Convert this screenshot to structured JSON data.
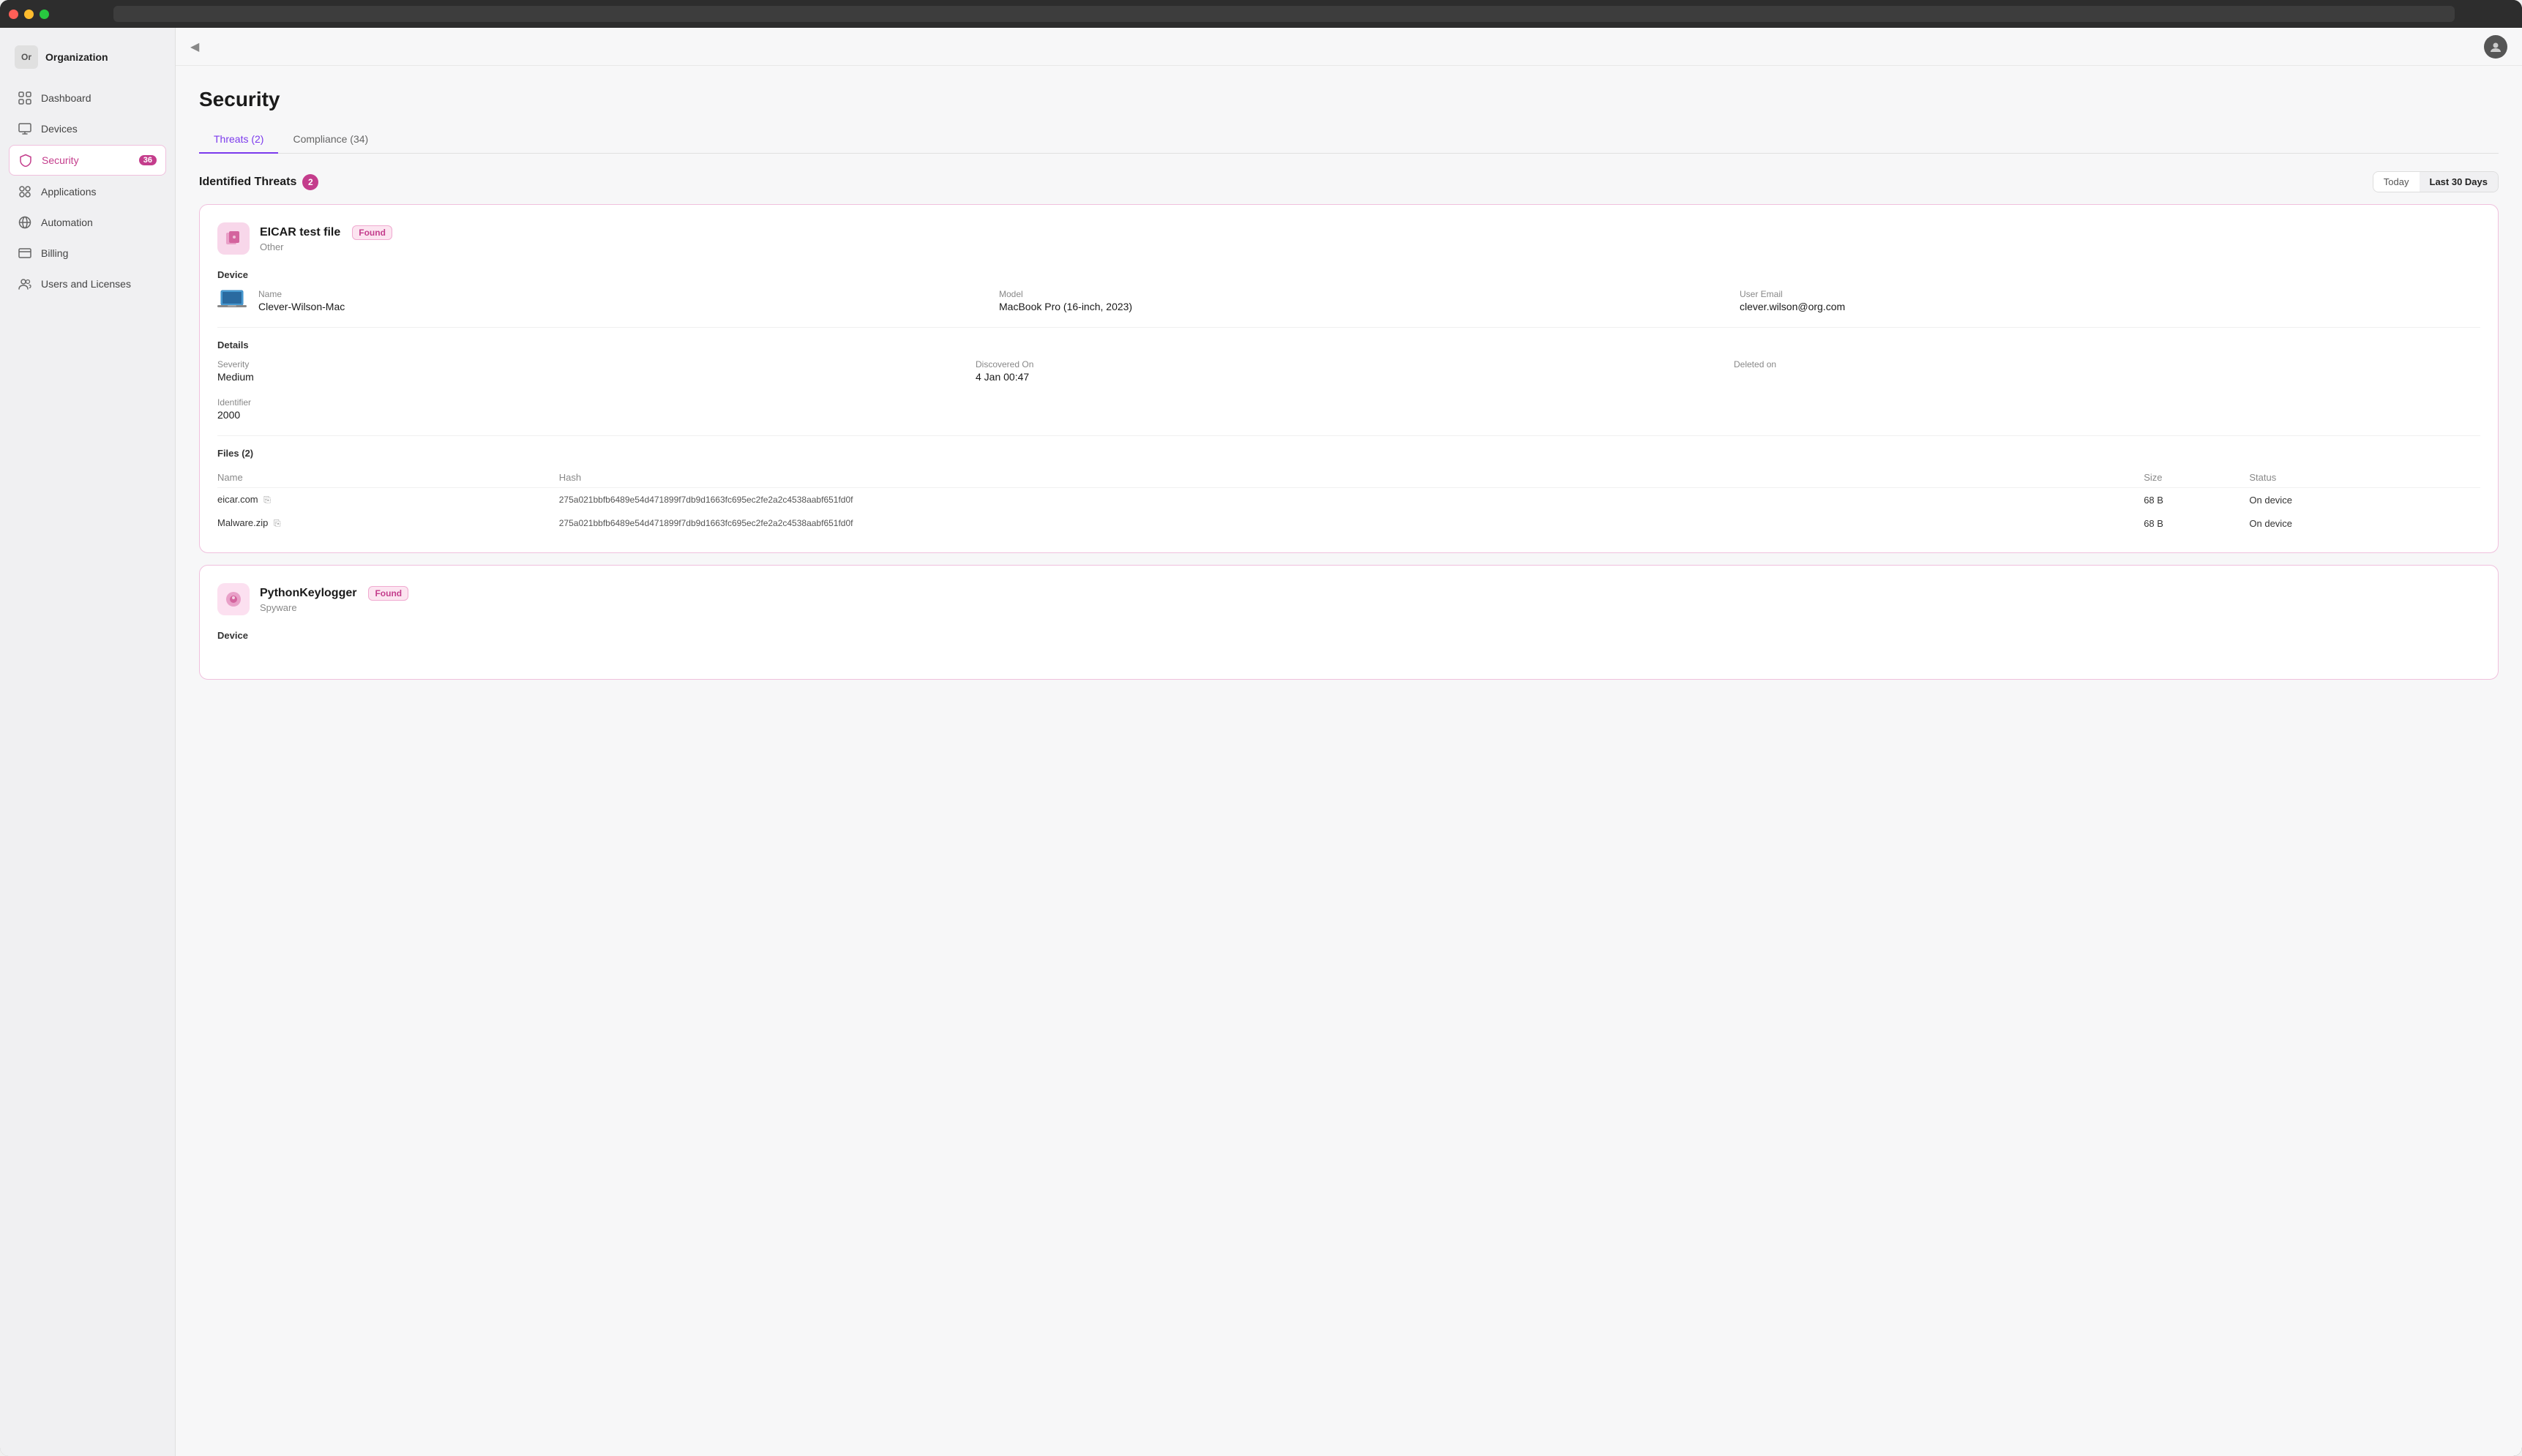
{
  "window": {
    "url": ""
  },
  "org": {
    "initials": "Or",
    "name": "Organization"
  },
  "sidebar": {
    "items": [
      {
        "id": "dashboard",
        "label": "Dashboard",
        "icon": "grid"
      },
      {
        "id": "devices",
        "label": "Devices",
        "icon": "monitor"
      },
      {
        "id": "security",
        "label": "Security",
        "icon": "shield",
        "badge": "36",
        "active": true
      },
      {
        "id": "applications",
        "label": "Applications",
        "icon": "grid-apps"
      },
      {
        "id": "automation",
        "label": "Automation",
        "icon": "globe"
      },
      {
        "id": "billing",
        "label": "Billing",
        "icon": "monitor2"
      },
      {
        "id": "users",
        "label": "Users and Licenses",
        "icon": "users"
      }
    ]
  },
  "topbar": {
    "collapse_icon": "◀",
    "user_avatar": "👤"
  },
  "page": {
    "title": "Security",
    "tabs": [
      {
        "id": "threats",
        "label": "Threats (2)",
        "active": true
      },
      {
        "id": "compliance",
        "label": "Compliance (34)",
        "active": false
      }
    ]
  },
  "threats_section": {
    "title": "Identified Threats",
    "count": "2",
    "date_buttons": [
      {
        "label": "Today",
        "active": false
      },
      {
        "label": "Last 30 Days",
        "active": true
      }
    ]
  },
  "threats": [
    {
      "id": "threat-1",
      "name": "EICAR test file",
      "status": "Found",
      "type": "Other",
      "device": {
        "name_label": "Name",
        "name_value": "Clever-Wilson-Mac",
        "model_label": "Model",
        "model_value": "MacBook Pro (16-inch, 2023)",
        "email_label": "User Email",
        "email_value": "clever.wilson@org.com"
      },
      "details": {
        "severity_label": "Severity",
        "severity_value": "Medium",
        "discovered_label": "Discovered On",
        "discovered_value": "4 Jan 00:47",
        "deleted_label": "Deleted on",
        "deleted_value": "",
        "identifier_label": "Identifier",
        "identifier_value": "2000"
      },
      "files_title": "Files (2)",
      "files_headers": [
        "Name",
        "Hash",
        "Size",
        "Status"
      ],
      "files": [
        {
          "name": "eicar.com",
          "hash": "275a021bbfb6489e54d471899f7db9d1663fc695ec2fe2a2c4538aabf651fd0f",
          "size": "68 B",
          "status": "On device"
        },
        {
          "name": "Malware.zip",
          "hash": "275a021bbfb6489e54d471899f7db9d1663fc695ec2fe2a2c4538aabf651fd0f",
          "size": "68 B",
          "status": "On device"
        }
      ]
    },
    {
      "id": "threat-2",
      "name": "PythonKeylogger",
      "status": "Found",
      "type": "Spyware",
      "device": null,
      "details": null,
      "files_title": "",
      "files": []
    }
  ]
}
